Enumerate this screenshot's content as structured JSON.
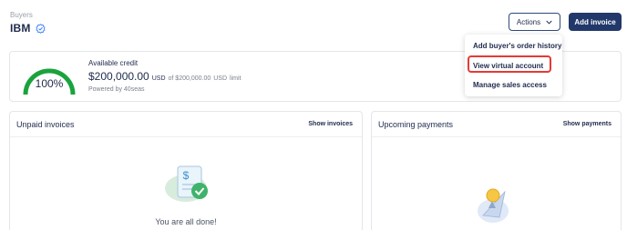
{
  "header": {
    "breadcrumb": "Buyers",
    "title": "IBM",
    "actions_label": "Actions",
    "add_invoice_label": "Add invoice"
  },
  "credit": {
    "label": "Available credit",
    "percent": "100%",
    "percent_value": 1.0,
    "amount": "$200,000.00",
    "currency": "USD",
    "limit_text": "of $200,000.00",
    "limit_currency": "USD",
    "limit_suffix": "limit",
    "powered_by": "Powered by 40seas"
  },
  "actions_menu": {
    "items": [
      {
        "label": "Add buyer's order history"
      },
      {
        "label": "View virtual account",
        "highlighted": true
      },
      {
        "label": "Manage sales access"
      }
    ]
  },
  "panels": {
    "unpaid": {
      "title": "Unpaid invoices",
      "link": "Show invoices",
      "empty_text": "You are all done!"
    },
    "upcoming": {
      "title": "Upcoming payments",
      "link": "Show payments"
    }
  },
  "colors": {
    "primary": "#22386b",
    "gauge_green": "#1aa33c",
    "highlight_red": "#e53935",
    "verified_blue": "#3b82f6"
  },
  "icons": [
    "verified-check-icon",
    "chevron-down-icon",
    "invoice-done-illustration",
    "rocket-illustration"
  ]
}
